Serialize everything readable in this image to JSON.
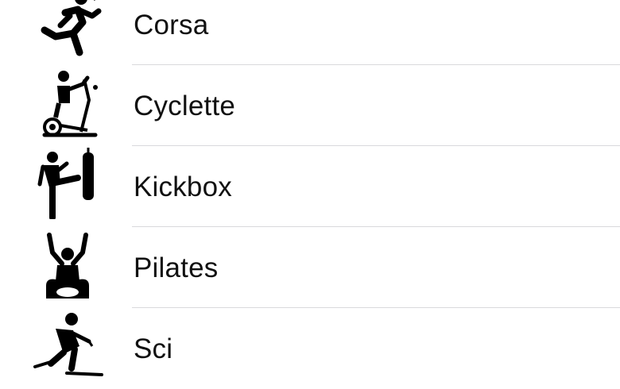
{
  "workouts": {
    "items": [
      {
        "label": "Corsa",
        "icon": "running-icon"
      },
      {
        "label": "Cyclette",
        "icon": "elliptical-bike-icon"
      },
      {
        "label": "Kickbox",
        "icon": "kickboxing-icon"
      },
      {
        "label": "Pilates",
        "icon": "pilates-icon"
      },
      {
        "label": "Sci",
        "icon": "skiing-icon"
      }
    ]
  }
}
